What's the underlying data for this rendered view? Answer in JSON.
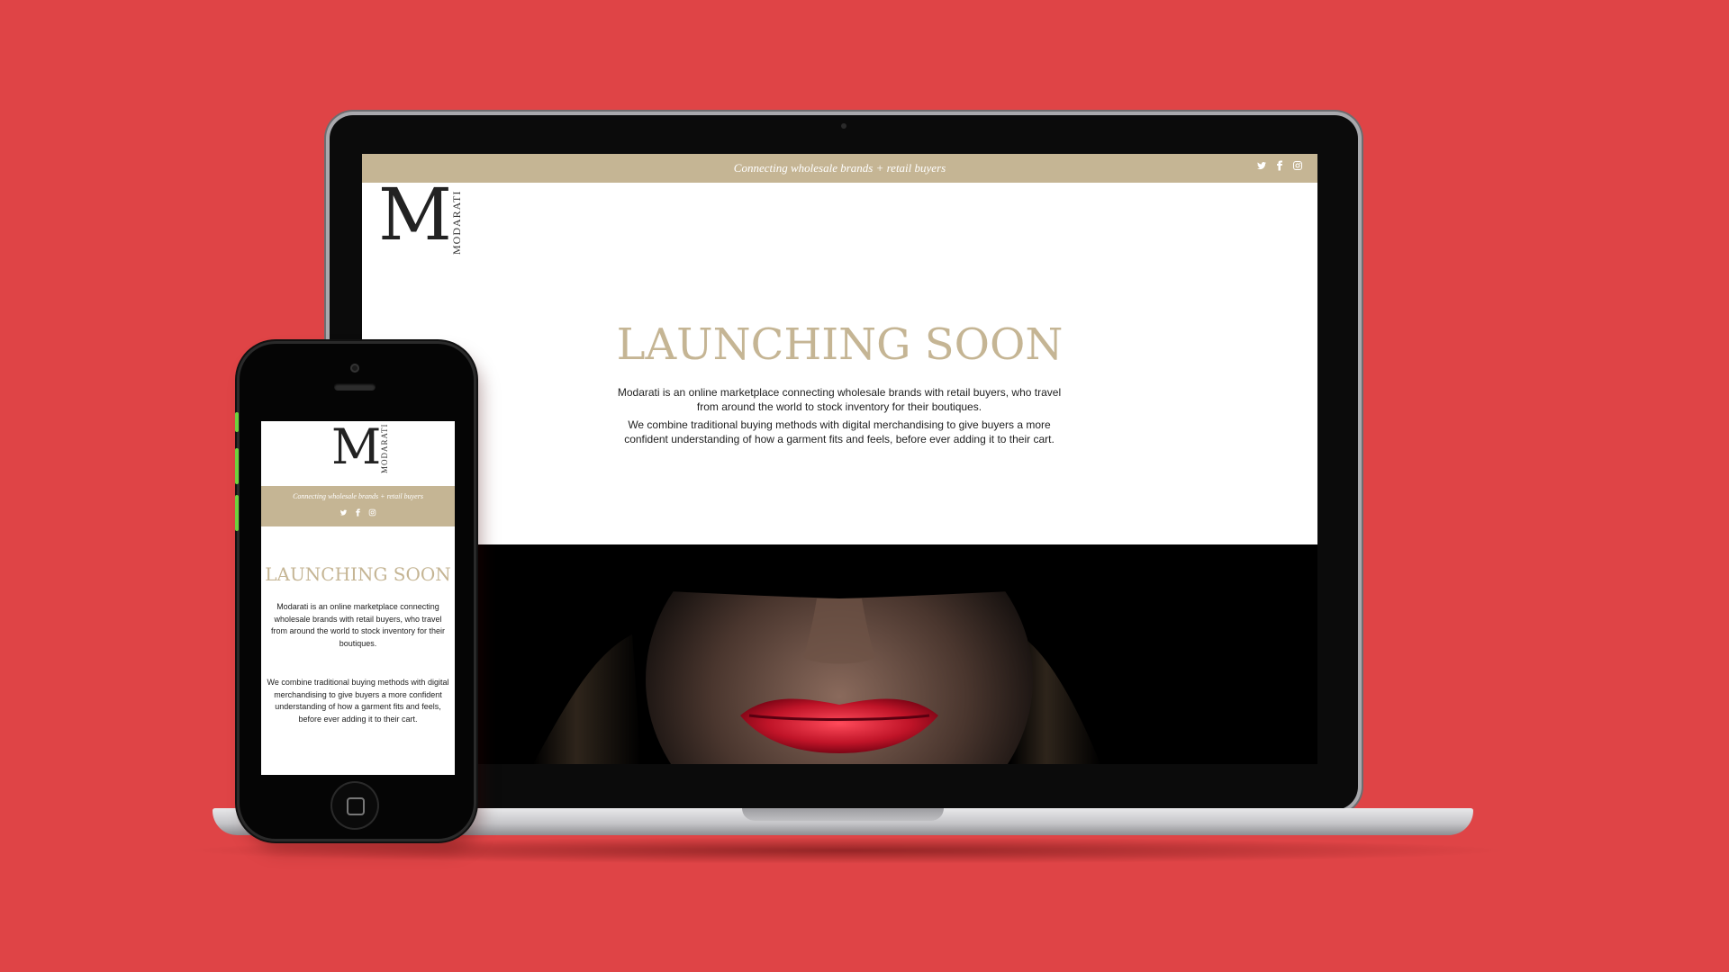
{
  "desktop": {
    "tagline": "Connecting wholesale brands + retail buyers",
    "social": [
      "twitter-icon",
      "facebook-icon",
      "instagram-icon"
    ],
    "logo_letter": "M",
    "logo_word": "MODARATI",
    "heading": "LAUNCHING SOON",
    "paragraph_1": "Modarati is an online marketplace connecting wholesale brands with retail buyers, who travel from around the world to stock inventory for their boutiques.",
    "paragraph_2": "We combine traditional buying methods with digital merchandising to give buyers a more confident understanding of how a garment fits and feels, before ever adding it to their cart."
  },
  "mobile": {
    "logo_letter": "M",
    "logo_word": "MODARATI",
    "tagline": "Connecting wholesale brands + retail buyers",
    "heading": "LAUNCHING SOON",
    "paragraph_1": "Modarati is an online marketplace connecting wholesale brands with retail buyers, who travel from around the world to stock inventory for their boutiques.",
    "paragraph_2": "We combine traditional buying methods with digital merchandising to give buyers a more confident understanding of how a garment fits and feels, before ever adding it to their cart."
  },
  "colors": {
    "background": "#df4446",
    "brand_gold": "#c5b594",
    "logo_dark": "#222222"
  }
}
